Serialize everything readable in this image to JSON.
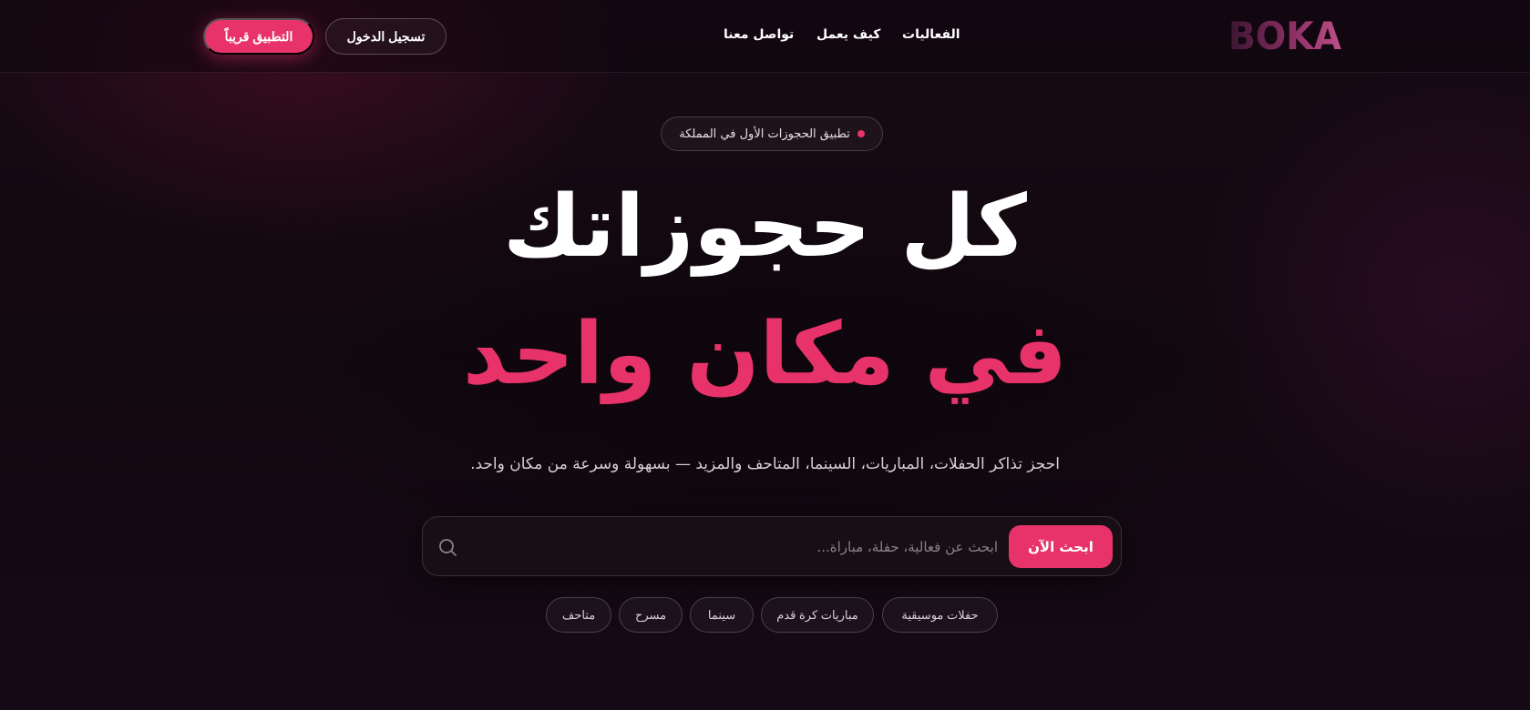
{
  "header": {
    "logo_text": "BOKA",
    "nav": [
      {
        "label": "الفعاليات"
      },
      {
        "label": "كيف يعمل"
      },
      {
        "label": "تواصل معنا"
      }
    ],
    "login_label": "تسجيل الدخول",
    "app_label": "التطبيق قريباً"
  },
  "badge": {
    "text": "تطبيق الحجوزات الأول في المملكة"
  },
  "hero": {
    "line1": "كل حجوزاتك",
    "line2": "في مكان واحد",
    "subtitle": "احجز تذاكر الحفلات، المباريات، السينما، المتاحف والمزيد — بسهولة وسرعة من مكان واحد."
  },
  "search": {
    "placeholder": "ابحث عن فعالية، حفلة، مباراة...",
    "value": "",
    "button_label": "ابحث الآن"
  },
  "chips": [
    {
      "label": "حفلات موسيقية"
    },
    {
      "label": "مباريات كرة قدم"
    },
    {
      "label": "سينما"
    },
    {
      "label": "مسرح"
    },
    {
      "label": "متاحف"
    }
  ],
  "colors": {
    "accent": "#e8336a",
    "background": "#120810",
    "text": "#ffffff"
  }
}
